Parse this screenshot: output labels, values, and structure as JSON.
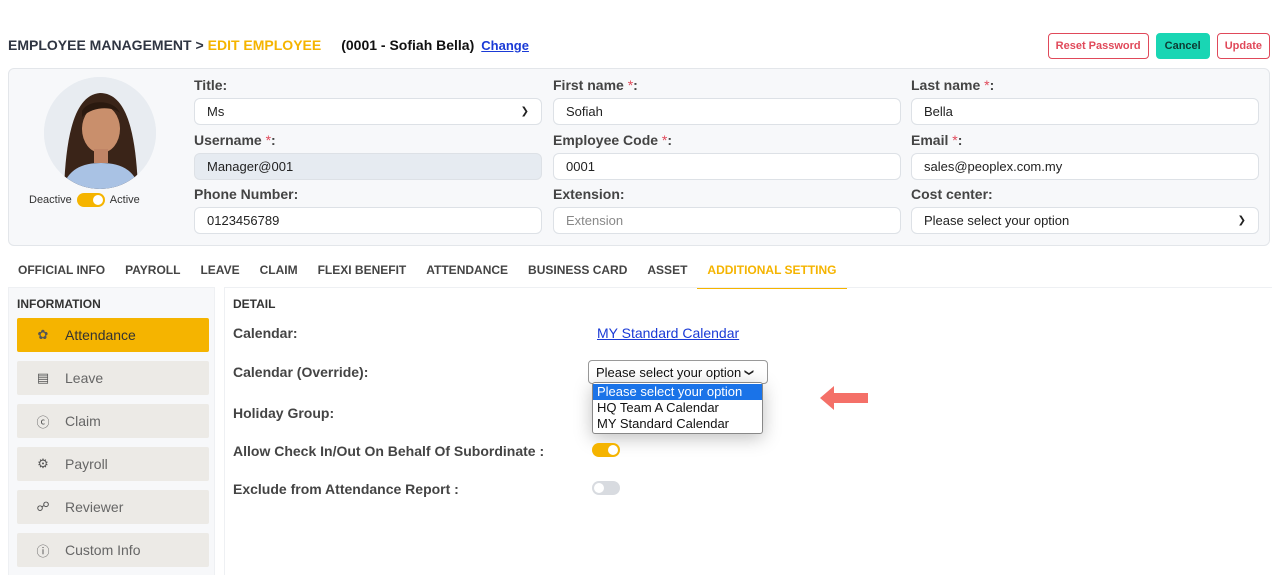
{
  "header": {
    "section": "EMPLOYEE MANAGEMENT >",
    "page": "EDIT EMPLOYEE",
    "employee": "(0001 - Sofiah Bella)",
    "change_link": "Change"
  },
  "buttons": {
    "reset_password": "Reset Password",
    "cancel": "Cancel",
    "update": "Update"
  },
  "profile": {
    "status_off": "Deactive",
    "status_on": "Active",
    "title": {
      "label": "Title:",
      "value": "Ms"
    },
    "first_name": {
      "label": "First name",
      "value": "Sofiah"
    },
    "last_name": {
      "label": "Last name",
      "value": "Bella"
    },
    "username": {
      "label": "Username",
      "value": "Manager@001"
    },
    "employee_code": {
      "label": "Employee Code",
      "value": "0001"
    },
    "email": {
      "label": "Email",
      "value": "sales@peoplex.com.my"
    },
    "phone": {
      "label": "Phone Number:",
      "value": "0123456789"
    },
    "extension": {
      "label": "Extension:",
      "placeholder": "Extension"
    },
    "cost_center": {
      "label": "Cost center:",
      "value": "Please select your option"
    },
    "required_mark": "*",
    "colon": ":"
  },
  "tabs": [
    "OFFICIAL INFO",
    "PAYROLL",
    "LEAVE",
    "CLAIM",
    "FLEXI BENEFIT",
    "ATTENDANCE",
    "BUSINESS CARD",
    "ASSET",
    "ADDITIONAL SETTING"
  ],
  "active_tab": "ADDITIONAL SETTING",
  "sidebar": {
    "title": "INFORMATION",
    "items": [
      {
        "label": "Attendance",
        "icon": "fingerprint-icon"
      },
      {
        "label": "Leave",
        "icon": "calendar-icon"
      },
      {
        "label": "Claim",
        "icon": "dollar-circle-icon"
      },
      {
        "label": "Payroll",
        "icon": "gear-icon"
      },
      {
        "label": "Reviewer",
        "icon": "hierarchy-icon"
      },
      {
        "label": "Custom Info",
        "icon": "info-icon"
      }
    ]
  },
  "detail": {
    "title": "DETAIL",
    "calendar_label": "Calendar:",
    "calendar_value": "MY Standard Calendar",
    "calendar_override_label": "Calendar (Override):",
    "calendar_override_value": "Please select your option",
    "calendar_override_options": [
      "Please select your option",
      "HQ Team A Calendar",
      "MY Standard Calendar"
    ],
    "holiday_group_label": "Holiday Group:",
    "allow_checkin_label": "Allow Check In/Out On Behalf Of Subordinate :",
    "allow_checkin_on": true,
    "exclude_report_label": "Exclude from Attendance Report :",
    "exclude_report_on": false
  },
  "colors": {
    "accent": "#f5b400",
    "danger": "#e0495a",
    "cancel": "#19d6b4",
    "link": "#1a3ad6",
    "arrow": "#f47068"
  }
}
